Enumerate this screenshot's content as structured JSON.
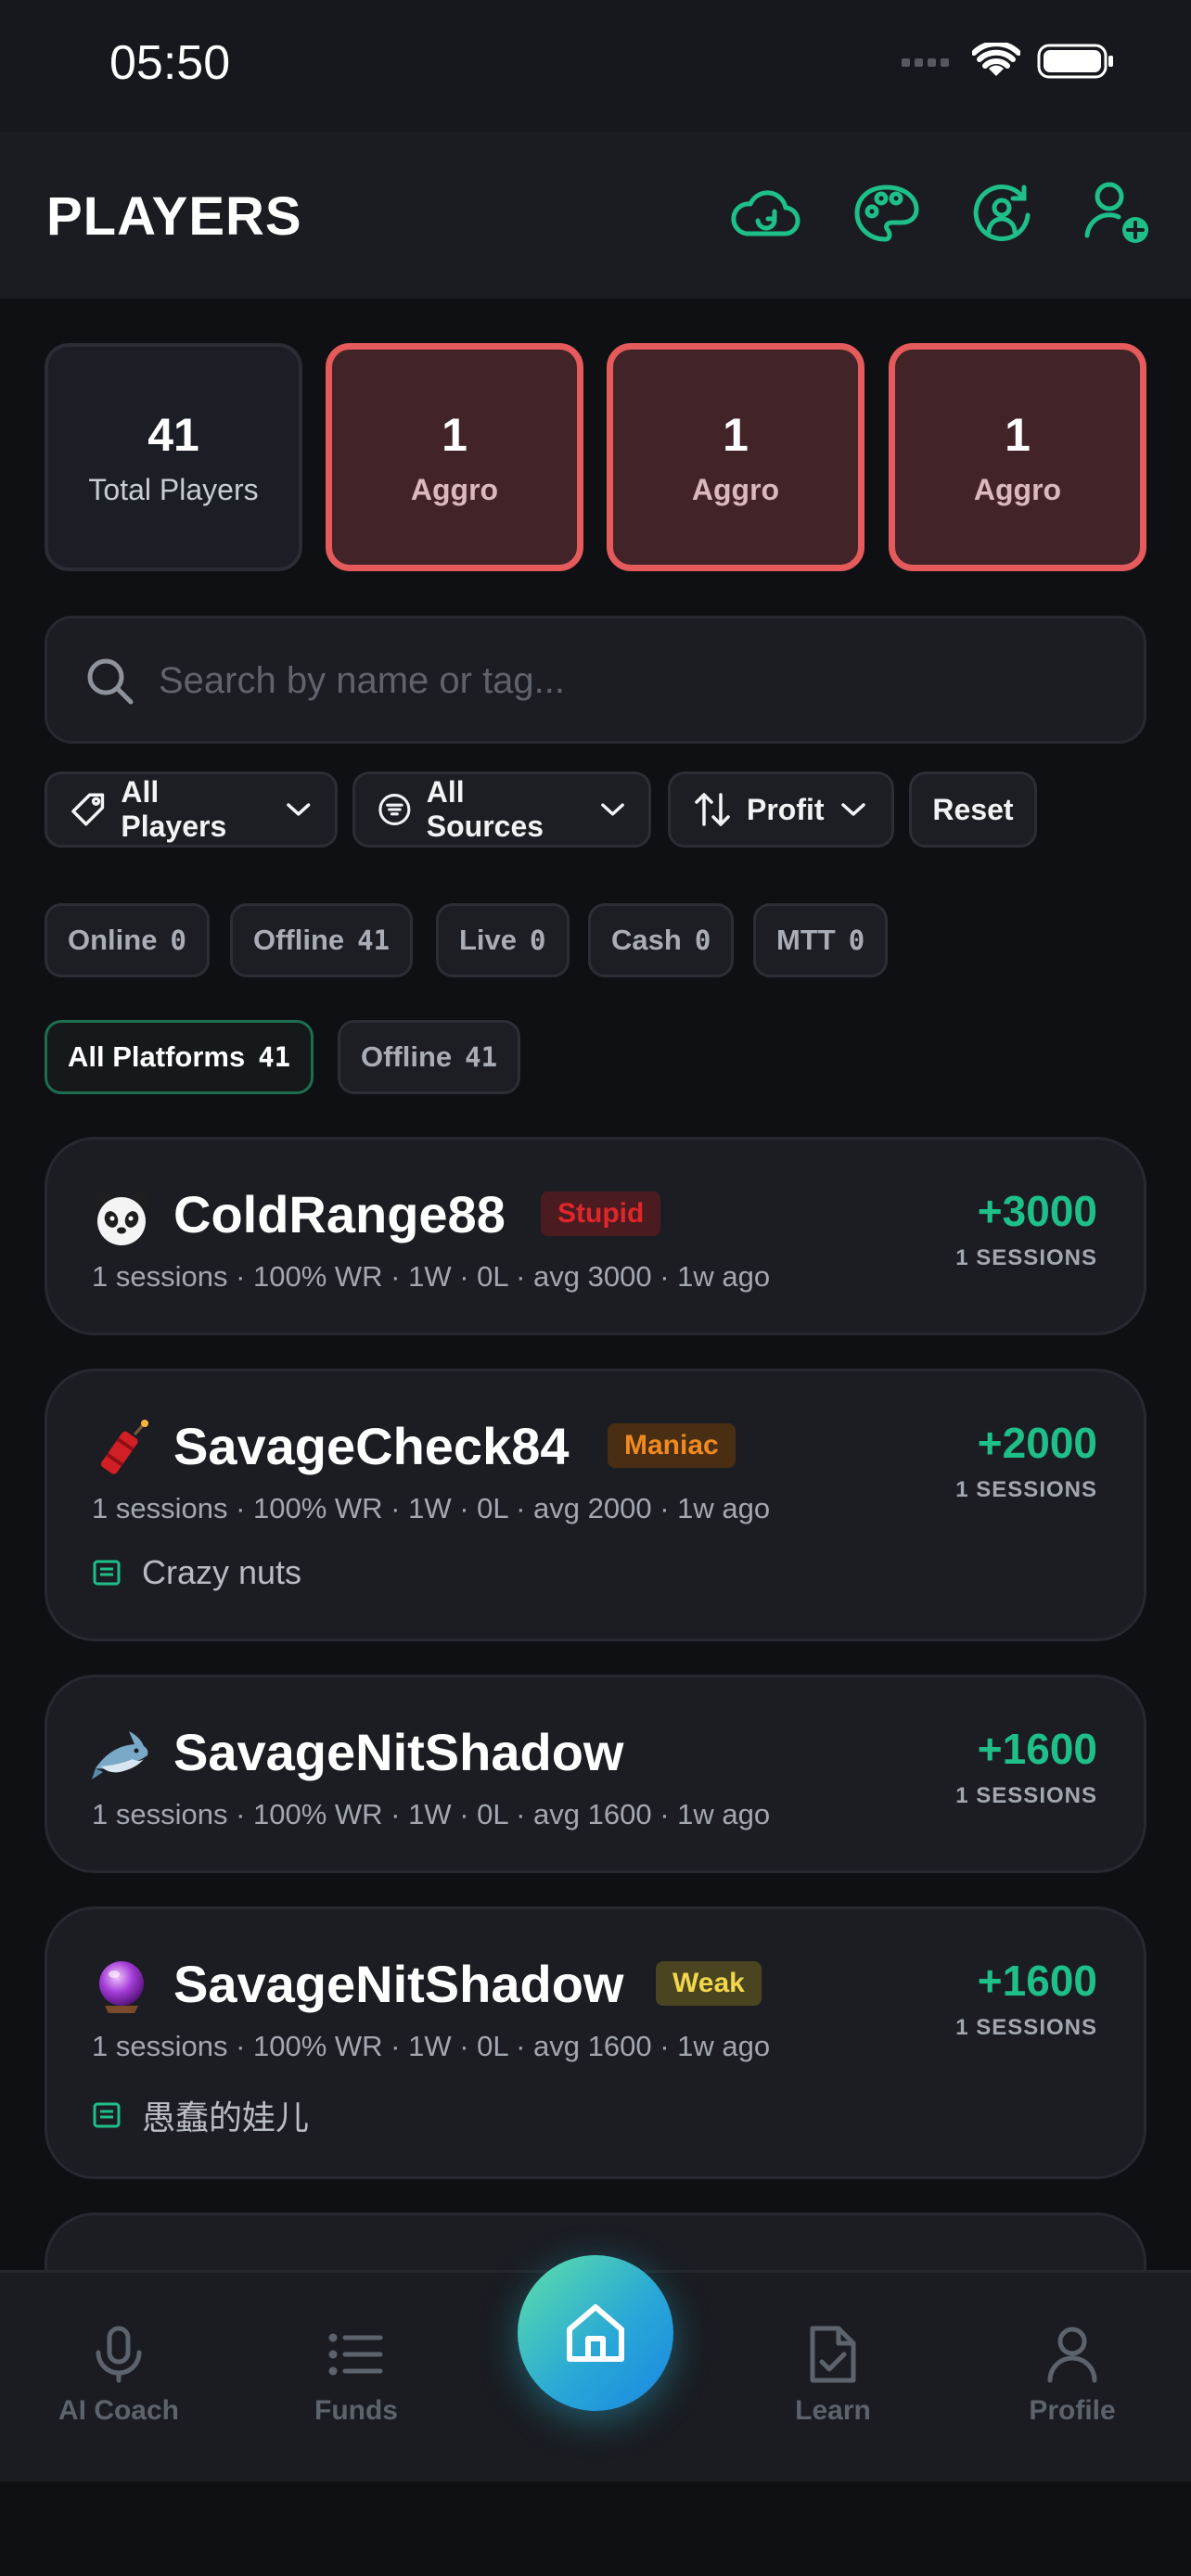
{
  "status_bar": {
    "time": "05:50"
  },
  "header": {
    "title": "PLAYERS"
  },
  "stats": [
    {
      "value": "41",
      "label": "Total Players",
      "kind": "total"
    },
    {
      "value": "1",
      "label": "Aggro",
      "kind": "aggro"
    },
    {
      "value": "1",
      "label": "Aggro",
      "kind": "aggro"
    },
    {
      "value": "1",
      "label": "Aggro",
      "kind": "aggro"
    }
  ],
  "search": {
    "placeholder": "Search by name or tag..."
  },
  "filters": {
    "players": "All Players",
    "sources": "All Sources",
    "sort": "Profit",
    "reset": "Reset"
  },
  "type_chips": [
    {
      "label": "Online",
      "count": "0"
    },
    {
      "label": "Offline",
      "count": "41"
    },
    {
      "label": "Live",
      "count": "0"
    },
    {
      "label": "Cash",
      "count": "0"
    },
    {
      "label": "MTT",
      "count": "0"
    }
  ],
  "platform_chips": [
    {
      "label": "All Platforms",
      "count": "41",
      "active": true
    },
    {
      "label": "Offline",
      "count": "41",
      "active": false
    }
  ],
  "players": [
    {
      "icon": "panda-icon",
      "name": "ColdRange88",
      "tag": "Stupid",
      "tag_color": "#e0262b",
      "tag_bg": "#4a1c1f",
      "meta": "1 sessions · 100% WR · 1W · 0L · avg 3000 · 1w ago",
      "profit": "+3000",
      "sessions": "1 SESSIONS",
      "note": ""
    },
    {
      "icon": "firecracker-icon",
      "name": "SavageCheck84",
      "tag": "Maniac",
      "tag_color": "#f08a1e",
      "tag_bg": "#4a2e14",
      "meta": "1 sessions · 100% WR · 1W · 0L · avg 2000 · 1w ago",
      "profit": "+2000",
      "sessions": "1 SESSIONS",
      "note": "Crazy nuts"
    },
    {
      "icon": "shark-icon",
      "name": "SavageNitShadow",
      "tag": "",
      "tag_color": "",
      "tag_bg": "",
      "meta": "1 sessions · 100% WR · 1W · 0L · avg 1600 · 1w ago",
      "profit": "+1600",
      "sessions": "1 SESSIONS",
      "note": ""
    },
    {
      "icon": "crystal-ball-icon",
      "name": "SavageNitShadow",
      "tag": "Weak",
      "tag_color": "#f2d64b",
      "tag_bg": "#4a4420",
      "meta": "1 sessions · 100% WR · 1W · 0L · avg 1600 · 1w ago",
      "profit": "+1600",
      "sessions": "1 SESSIONS",
      "note": "愚蠢的娃儿"
    }
  ],
  "tabbar": {
    "ai_coach": "AI Coach",
    "funds": "Funds",
    "learn": "Learn",
    "profile": "Profile"
  },
  "colors": {
    "accent": "#1fbf8a",
    "aggro_border": "#e55a5a",
    "background": "#0f1014"
  }
}
